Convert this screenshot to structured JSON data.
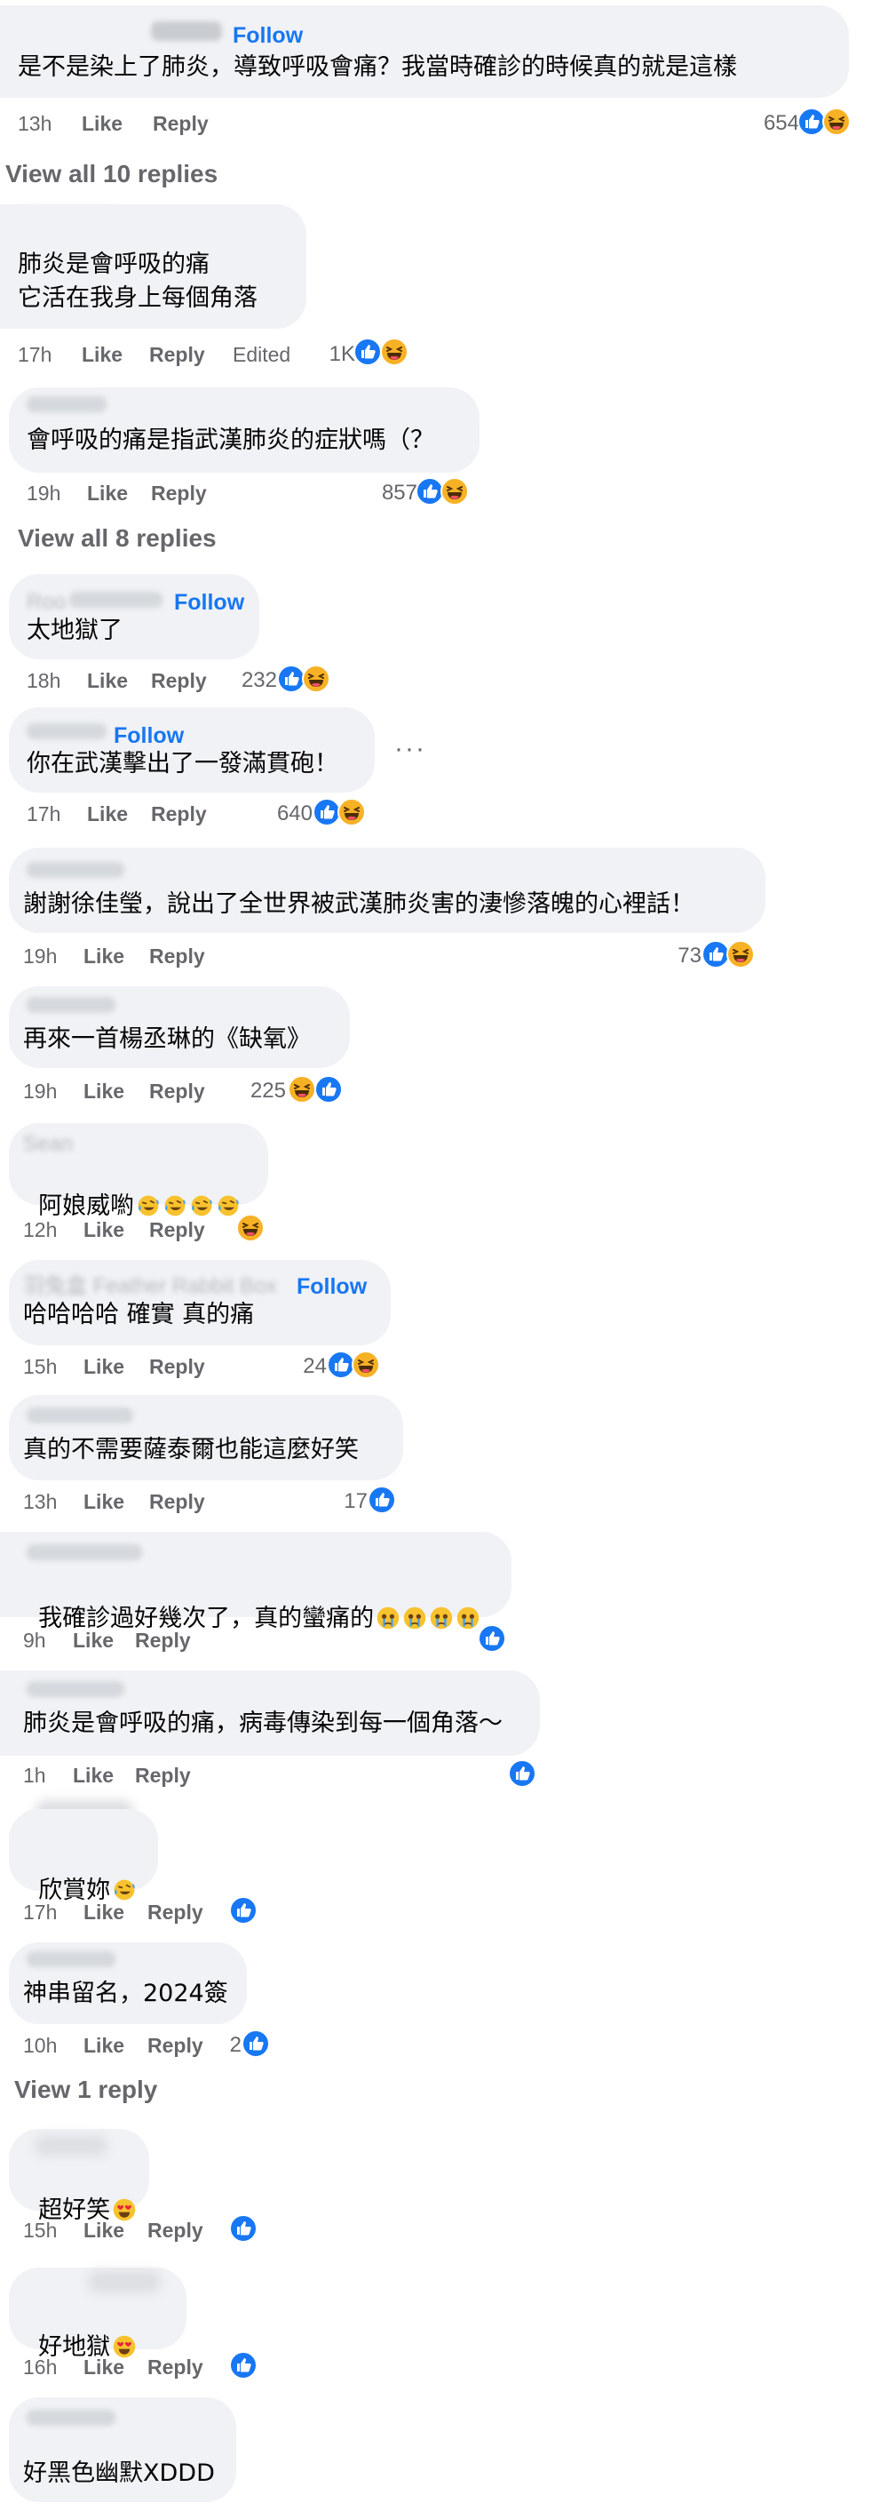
{
  "comments": [
    {
      "name": "",
      "follow": "Follow",
      "text": "是不是染上了肺炎，導致呼吸會痛？我當時確診的時候真的就是這樣",
      "time": "13h",
      "like": "Like",
      "reply": "Reply",
      "count": "654"
    },
    {
      "text1": "肺炎是會呼吸的痛",
      "text2": "它活在我身上每個角落",
      "time": "17h",
      "like": "Like",
      "reply": "Reply",
      "edited": "Edited",
      "count": "1K"
    },
    {
      "text": "會呼吸的痛是指武漢肺炎的症狀嗎（？",
      "time": "19h",
      "like": "Like",
      "reply": "Reply",
      "count": "857"
    },
    {
      "name": "Roo",
      "follow": "Follow",
      "text": "太地獄了",
      "time": "18h",
      "like": "Like",
      "reply": "Reply",
      "count": "232"
    },
    {
      "follow": "Follow",
      "text": "你在武漢擊出了一發滿貫砲！",
      "time": "17h",
      "like": "Like",
      "reply": "Reply",
      "count": "640"
    },
    {
      "name": "",
      "text": "謝謝徐佳瑩，說出了全世界被武漢肺炎害的淒慘落魄的心裡話！",
      "time": "19h",
      "like": "Like",
      "reply": "Reply",
      "count": "73"
    },
    {
      "text": "再來一首楊丞琳的《缺氧》",
      "time": "19h",
      "like": "Like",
      "reply": "Reply",
      "count": "225"
    },
    {
      "name": "Sean",
      "text": "阿娘威喲",
      "time": "12h",
      "like": "Like",
      "reply": "Reply"
    },
    {
      "name": "羽兔盒 Feather Rabbit Box",
      "follow": "Follow",
      "text": "哈哈哈哈 確實 真的痛",
      "time": "15h",
      "like": "Like",
      "reply": "Reply",
      "count": "24"
    },
    {
      "text": "真的不需要薩泰爾也能這麼好笑",
      "time": "13h",
      "like": "Like",
      "reply": "Reply",
      "count": "17"
    },
    {
      "text": "我確診過好幾次了，真的蠻痛的",
      "time": "9h",
      "like": "Like",
      "reply": "Reply"
    },
    {
      "text": "肺炎是會呼吸的痛，病毒傳染到每一個角落～",
      "time": "1h",
      "like": "Like",
      "reply": "Reply"
    },
    {
      "text": "欣賞妳",
      "time": "17h",
      "like": "Like",
      "reply": "Reply"
    },
    {
      "text": "神串留名，2024簽",
      "time": "10h",
      "like": "Like",
      "reply": "Reply",
      "count": "2"
    },
    {
      "text": "超好笑",
      "time": "15h",
      "like": "Like",
      "reply": "Reply"
    },
    {
      "text": "好地獄",
      "time": "16h",
      "like": "Like",
      "reply": "Reply"
    },
    {
      "text": "好黑色幽默XDDD"
    }
  ],
  "view_all_10": "View all 10 replies",
  "view_all_8": "View all 8 replies",
  "view_1": "View 1 reply",
  "more_dots": "···",
  "colors": {
    "bubble": "#f0f2f5",
    "link": "#1877f2",
    "meta": "#65676b",
    "like_blue": "#1877f2",
    "haha_yellow": "#f7b125"
  },
  "icons": [
    "like-reaction-icon",
    "haha-reaction-icon",
    "laughing-crying-emoji-icon",
    "crying-face-emoji-icon",
    "heart-eyes-emoji-icon",
    "more-options-icon"
  ]
}
